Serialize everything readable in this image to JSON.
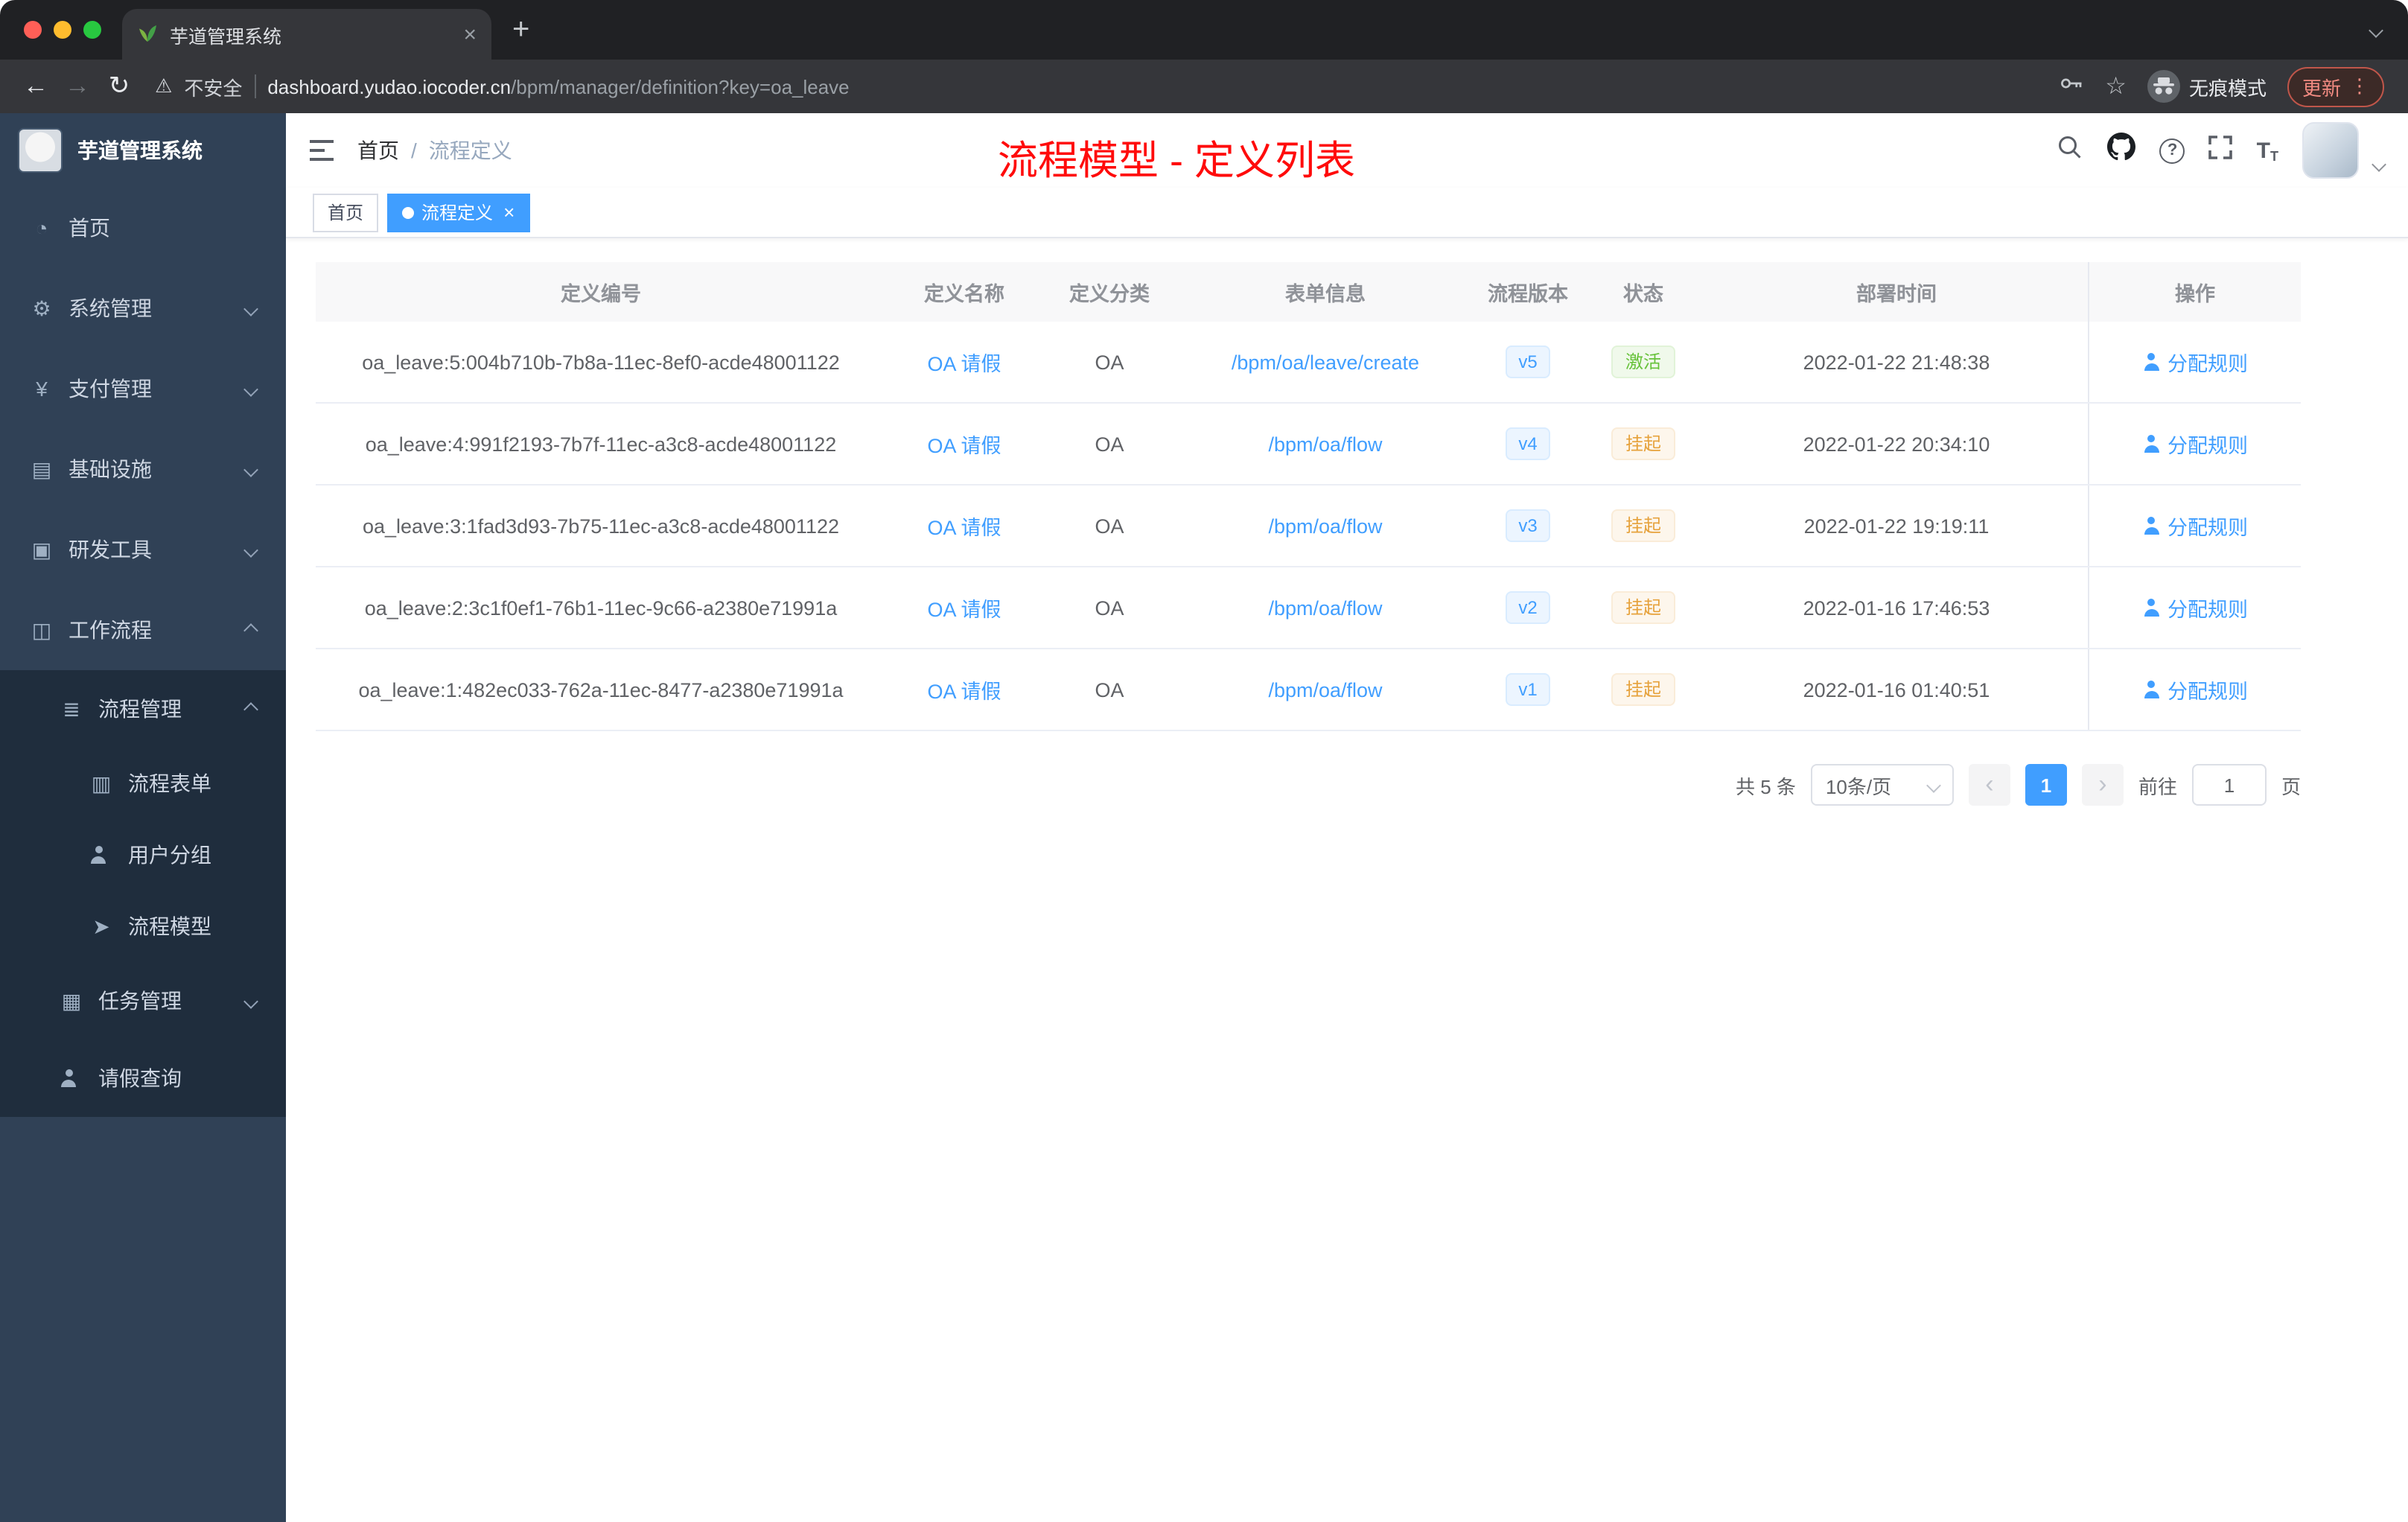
{
  "colors": {
    "accent": "#409eff",
    "success": "#67c23a",
    "warning": "#e6a23c",
    "title_red": "#ff0b0b",
    "sidebar_bg": "#304156",
    "submenu_bg": "#1f2d3d"
  },
  "browser": {
    "tab_title": "芋道管理系统",
    "security_label": "不安全",
    "url_host": "dashboard.yudao.iocoder.cn",
    "url_path": "/bpm/manager/definition?key=oa_leave",
    "incognito_label": "无痕模式",
    "update_label": "更新",
    "icons": {
      "back": "←",
      "forward": "→",
      "reload": "↻",
      "warning": "⚠",
      "star": "☆",
      "menu_dots": "⋮",
      "tab_close": "×",
      "new_tab": "+"
    }
  },
  "sidebar": {
    "logo_title": "芋道管理系统",
    "menu": [
      {
        "name": "home",
        "label": "首页",
        "icon": "dashboard-icon",
        "glyph": "◔",
        "level": 1
      },
      {
        "name": "system-management",
        "label": "系统管理",
        "icon": "gear-icon",
        "glyph": "⚙",
        "level": 1,
        "arrow": "down"
      },
      {
        "name": "payment-management",
        "label": "支付管理",
        "icon": "yen-icon",
        "glyph": "¥",
        "level": 1,
        "arrow": "down"
      },
      {
        "name": "infrastructure",
        "label": "基础设施",
        "icon": "infrastructure-icon",
        "glyph": "▤",
        "level": 1,
        "arrow": "down"
      },
      {
        "name": "dev-tools",
        "label": "研发工具",
        "icon": "dev-tools-icon",
        "glyph": "▣",
        "level": 1,
        "arrow": "down"
      },
      {
        "name": "workflow",
        "label": "工作流程",
        "icon": "workflow-icon",
        "glyph": "◫",
        "level": 1,
        "arrow": "up"
      },
      {
        "name": "process-management",
        "label": "流程管理",
        "icon": "process-management-icon",
        "glyph": "≣",
        "level": 2,
        "arrow": "up"
      },
      {
        "name": "process-form",
        "label": "流程表单",
        "icon": "form-icon",
        "glyph": "▥",
        "level": 3
      },
      {
        "name": "user-group",
        "label": "用户分组",
        "icon": "user-group-icon",
        "glyph": "person",
        "level": 3
      },
      {
        "name": "process-model",
        "label": "流程模型",
        "icon": "paper-plane-icon",
        "glyph": "➤",
        "level": 3
      },
      {
        "name": "task-management",
        "label": "任务管理",
        "icon": "task-icon",
        "glyph": "▦",
        "level": 2,
        "arrow": "down"
      },
      {
        "name": "leave-query",
        "label": "请假查询",
        "icon": "user-icon",
        "glyph": "person",
        "level": 2
      }
    ]
  },
  "header": {
    "breadcrumb_home": "首页",
    "breadcrumb_separator": "/",
    "breadcrumb_current": "流程定义",
    "page_title": "流程模型 - 定义列表",
    "icons": {
      "question": "?",
      "font_size_large": "T",
      "font_size_small": "T"
    }
  },
  "tags": {
    "home_label": "首页",
    "active_label": "流程定义",
    "close": "×"
  },
  "table": {
    "columns": [
      "定义编号",
      "定义名称",
      "定义分类",
      "表单信息",
      "流程版本",
      "状态",
      "部署时间",
      "操作"
    ],
    "rows": [
      {
        "id": "oa_leave:5:004b710b-7b8a-11ec-8ef0-acde48001122",
        "name": "OA 请假",
        "category": "OA",
        "form": "/bpm/oa/leave/create",
        "version": "v5",
        "status": "激活",
        "status_type": "success",
        "deploy_time": "2022-01-22 21:48:38",
        "action": "分配规则"
      },
      {
        "id": "oa_leave:4:991f2193-7b7f-11ec-a3c8-acde48001122",
        "name": "OA 请假",
        "category": "OA",
        "form": "/bpm/oa/flow",
        "version": "v4",
        "status": "挂起",
        "status_type": "warning",
        "deploy_time": "2022-01-22 20:34:10",
        "action": "分配规则"
      },
      {
        "id": "oa_leave:3:1fad3d93-7b75-11ec-a3c8-acde48001122",
        "name": "OA 请假",
        "category": "OA",
        "form": "/bpm/oa/flow",
        "version": "v3",
        "status": "挂起",
        "status_type": "warning",
        "deploy_time": "2022-01-22 19:19:11",
        "action": "分配规则"
      },
      {
        "id": "oa_leave:2:3c1f0ef1-76b1-11ec-9c66-a2380e71991a",
        "name": "OA 请假",
        "category": "OA",
        "form": "/bpm/oa/flow",
        "version": "v2",
        "status": "挂起",
        "status_type": "warning",
        "deploy_time": "2022-01-16 17:46:53",
        "action": "分配规则"
      },
      {
        "id": "oa_leave:1:482ec033-762a-11ec-8477-a2380e71991a",
        "name": "OA 请假",
        "category": "OA",
        "form": "/bpm/oa/flow",
        "version": "v1",
        "status": "挂起",
        "status_type": "warning",
        "deploy_time": "2022-01-16 01:40:51",
        "action": "分配规则"
      }
    ]
  },
  "pagination": {
    "total": "共 5 条",
    "page_size": "10条/页",
    "prev": "‹",
    "next": "›",
    "current_page": "1",
    "goto_label": "前往",
    "goto_value": "1",
    "page_unit": "页"
  }
}
